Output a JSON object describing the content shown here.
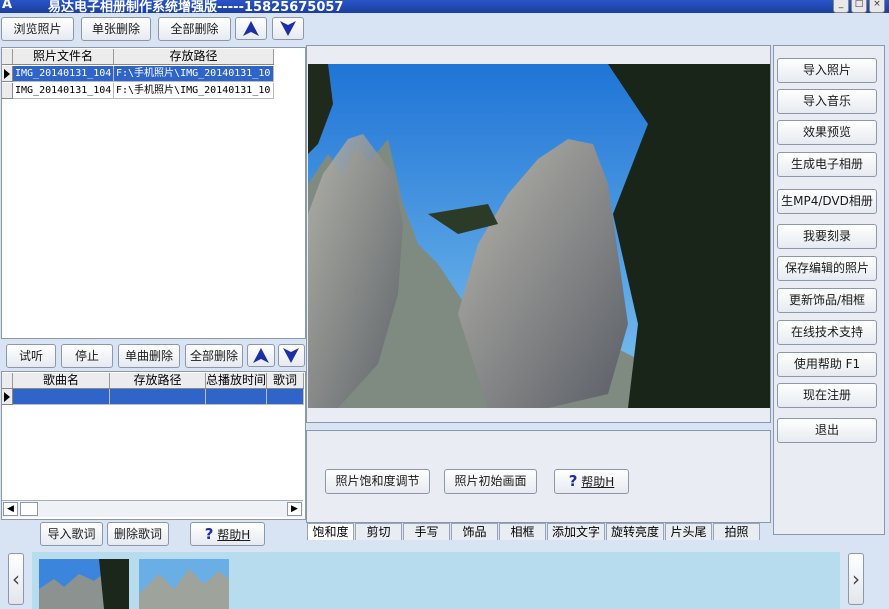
{
  "window": {
    "title": "易达电子相册制作系统增强版-----15825675057",
    "app_icon": "A",
    "controls": [
      "_",
      "□",
      "×"
    ]
  },
  "photo_toolbar": {
    "browse": "浏览照片",
    "delete_single": "单张删除",
    "delete_all": "全部删除"
  },
  "photo_table": {
    "columns": [
      "照片文件名",
      "存放路径"
    ],
    "rows": [
      {
        "name": "IMG_20140131_104",
        "path": "F:\\手机照片\\IMG_20140131_10"
      },
      {
        "name": "IMG_20140131_104",
        "path": "F:\\手机照片\\IMG_20140131_10"
      }
    ]
  },
  "music_toolbar": {
    "preview": "试听",
    "stop": "停止",
    "delete_single": "单曲删除",
    "delete_all": "全部删除"
  },
  "music_table": {
    "columns": [
      "歌曲名",
      "存放路径",
      "总播放时间",
      "歌词"
    ]
  },
  "lyrics_toolbar": {
    "import_lyrics": "导入歌词",
    "delete_lyrics": "删除歌词",
    "help": "帮助H"
  },
  "edit_panel": {
    "saturation": "照片饱和度调节",
    "initial_view": "照片初始画面",
    "help": "帮助H"
  },
  "tabs": [
    "饱和度",
    "剪切",
    "手写",
    "饰品",
    "相框",
    "添加文字",
    "旋转亮度",
    "片头尾",
    "拍照"
  ],
  "right_menu": [
    "导入照片",
    "导入音乐",
    "效果预览",
    "生成电子相册",
    "生MP4/DVD相册",
    "我要刻录",
    "保存编辑的照片",
    "更新饰品/相框",
    "在线技术支持",
    "使用帮助  F1",
    "现在注册",
    "退出"
  ],
  "colors": {
    "window_bg": "#d8e4f3",
    "titlebar": "#2a55c8",
    "selection": "#2f64c8",
    "thumb_strip": "#b7dced",
    "arrow_blue": "#1c2fa8"
  }
}
